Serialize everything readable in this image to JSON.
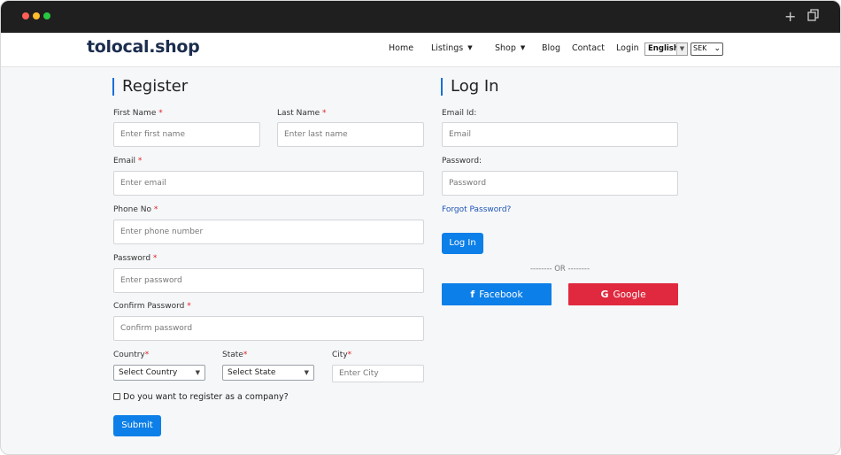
{
  "browser": {
    "dot_colors": [
      "#ff5f57",
      "#febc2e",
      "#28c840"
    ],
    "new_tab_icon": "plus-icon",
    "copy_icon": "copy-icon"
  },
  "nav": {
    "logo": "tolocal.shop",
    "items": [
      {
        "label": "Home"
      },
      {
        "label": "Listings",
        "dropdown": true
      },
      {
        "label": "Shop",
        "dropdown": true
      },
      {
        "label": "Blog"
      },
      {
        "label": "Contact"
      },
      {
        "label": "Login"
      }
    ],
    "language": "English",
    "currency": "SEK"
  },
  "register": {
    "heading": "Register",
    "first_name_label": "First Name",
    "first_name_placeholder": "Enter first name",
    "last_name_label": "Last Name",
    "last_name_placeholder": "Enter last name",
    "email_label": "Email",
    "email_placeholder": "Enter email",
    "phone_label": "Phone No",
    "phone_placeholder": "Enter phone number",
    "password_label": "Password",
    "password_placeholder": "Enter password",
    "confirm_label": "Confirm Password",
    "confirm_placeholder": "Confirm password",
    "required_mark": "*",
    "country_label": "Country",
    "country_value": "Select Country",
    "state_label": "State",
    "state_value": "Select State",
    "city_label": "City",
    "city_placeholder": "Enter City",
    "company_label": "Do you want to register as a company?",
    "submit_label": "Submit"
  },
  "login": {
    "heading": "Log In",
    "email_label": "Email Id:",
    "email_placeholder": "Email",
    "password_label": "Password:",
    "password_placeholder": "Password",
    "forgot_label": "Forgot Password?",
    "login_button": "Log In",
    "or_divider": "-------- OR --------",
    "facebook_label": "Facebook",
    "google_label": "Google"
  },
  "colors": {
    "accent": "#0d7fe8",
    "google": "#e0293e",
    "required": "#e02424"
  }
}
